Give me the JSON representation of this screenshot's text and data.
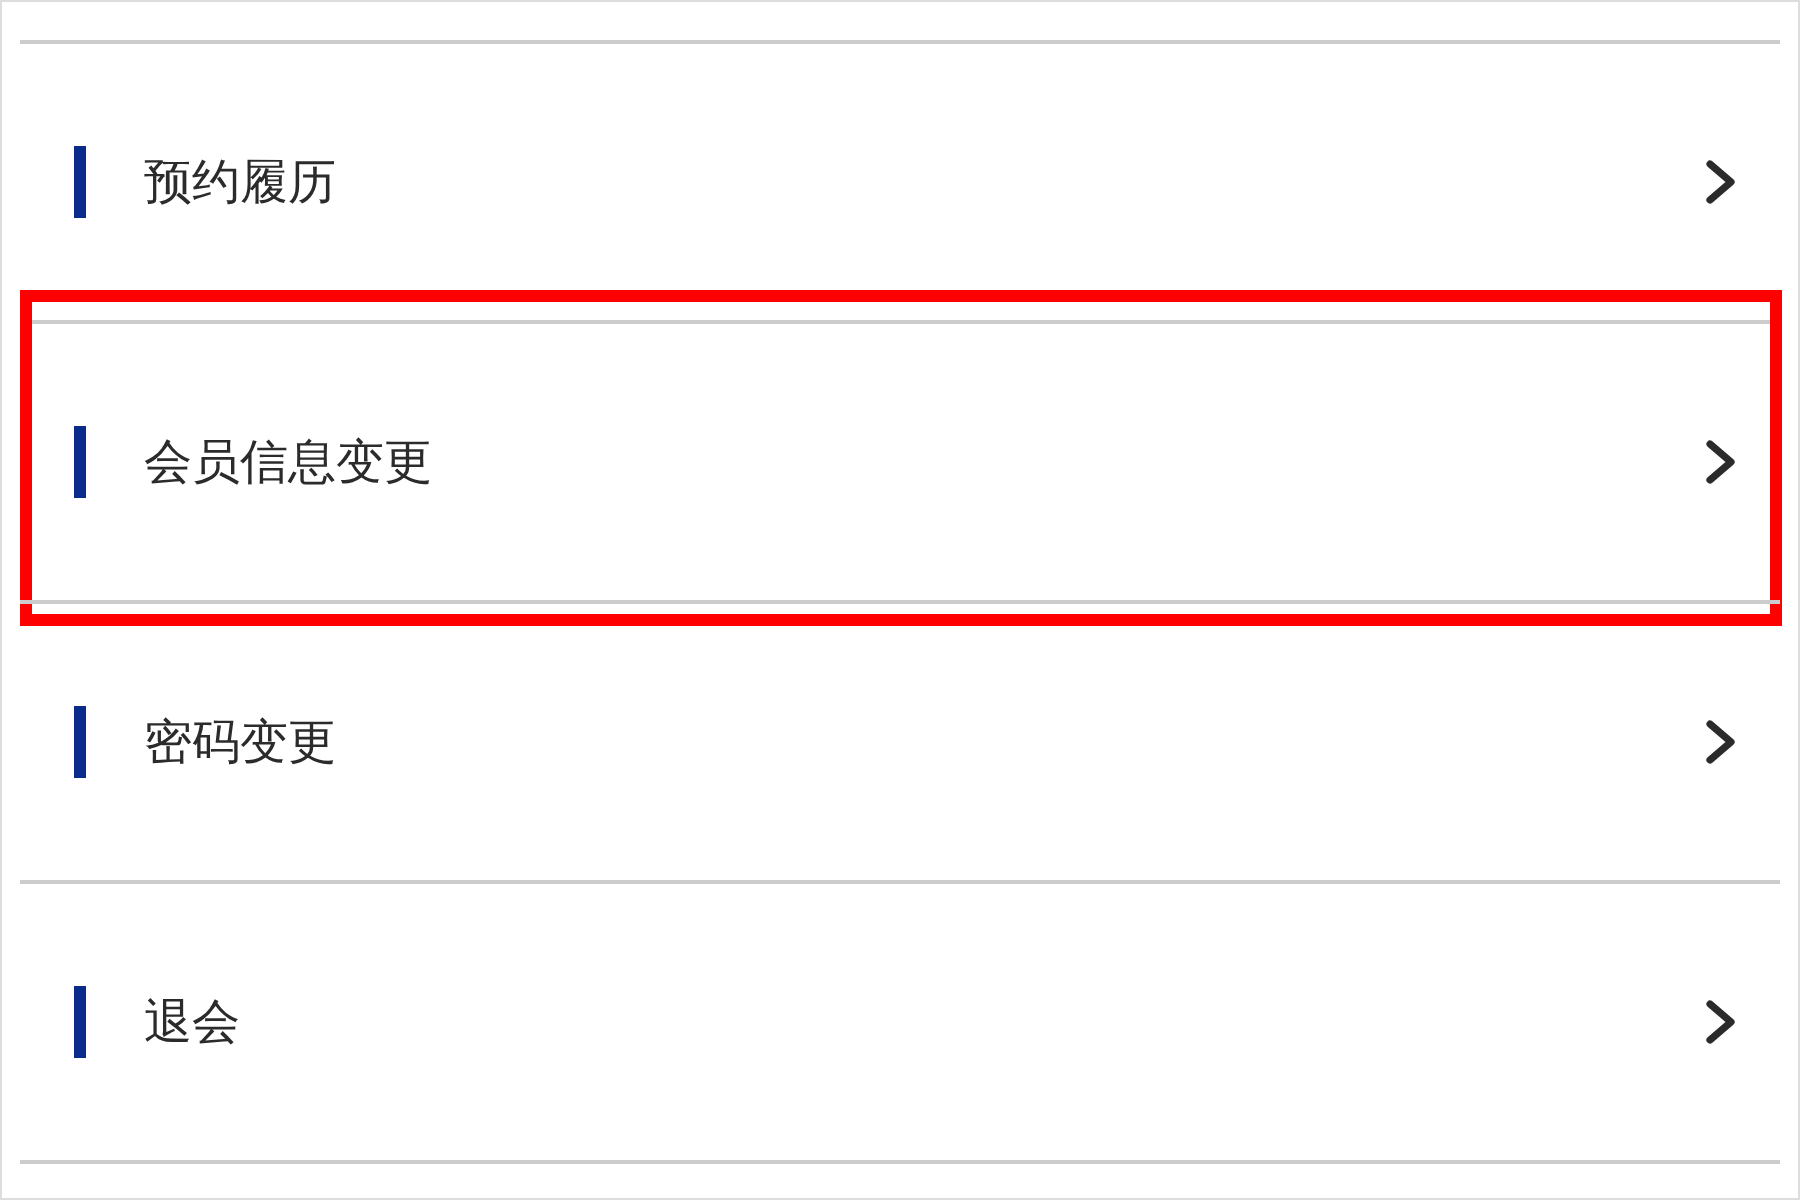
{
  "items": [
    {
      "label": "预约履历",
      "highlighted": false
    },
    {
      "label": "会员信息变更",
      "highlighted": true
    },
    {
      "label": "密码变更",
      "highlighted": false
    },
    {
      "label": "退会",
      "highlighted": false
    }
  ]
}
